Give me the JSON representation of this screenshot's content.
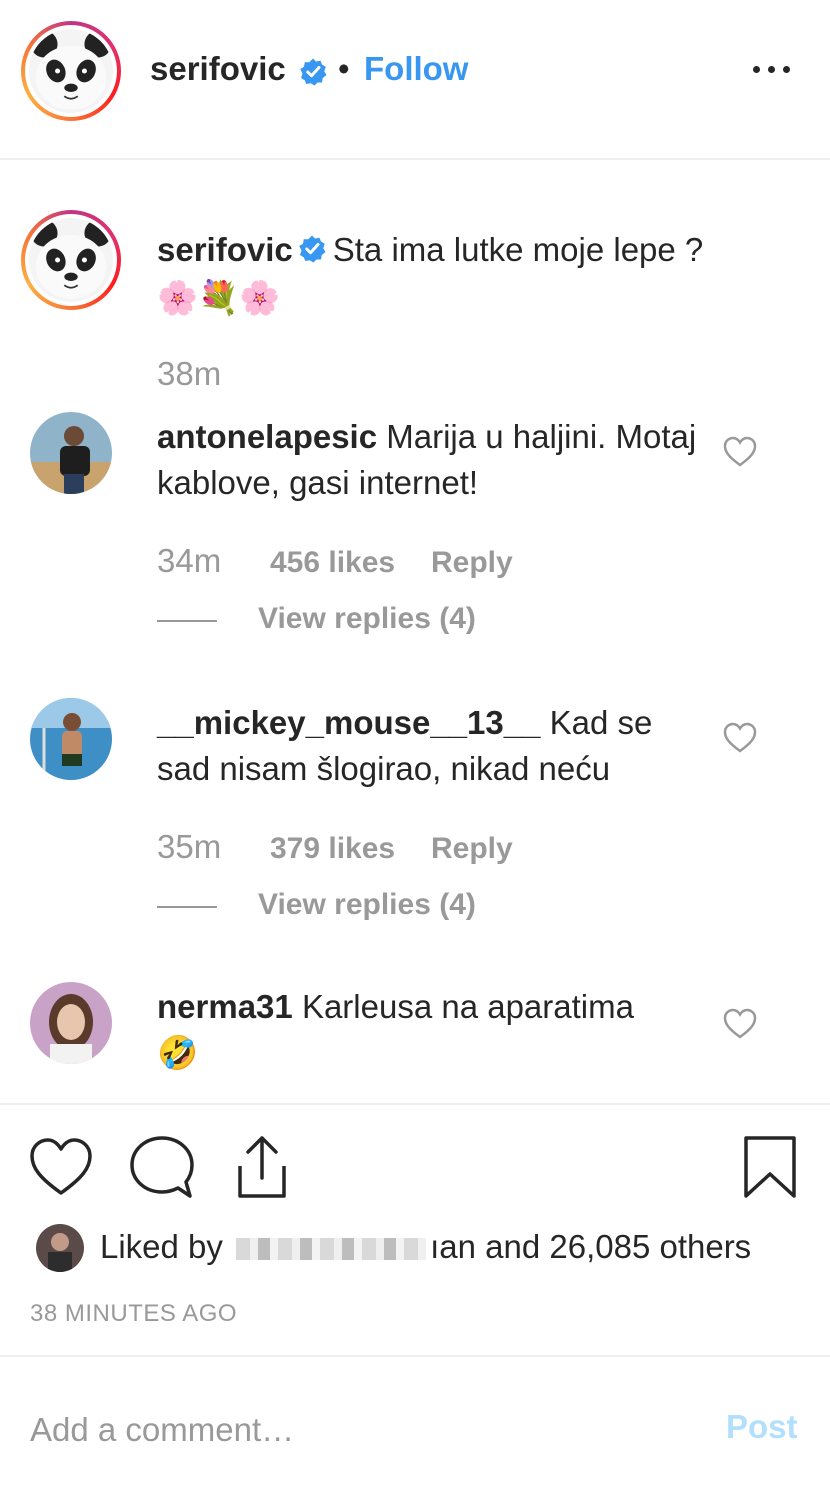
{
  "header": {
    "username": "serifovic",
    "separator": "•",
    "follow_label": "Follow"
  },
  "caption": {
    "username": "serifovic",
    "text": "Sta ima lutke moje lepe ?",
    "emojis": "🌸💐🌸",
    "time": "38m"
  },
  "comments": [
    {
      "username": "antonelapesic",
      "text": "Marija u haljini. Motaj kablove, gasi internet!",
      "time": "34m",
      "likes": "456 likes",
      "reply_label": "Reply",
      "view_replies": "View replies (4)"
    },
    {
      "username": "__mickey_mouse__13__",
      "text": "Kad se sad nisam šlogirao, nikad neću",
      "time": "35m",
      "likes": "379 likes",
      "reply_label": "Reply",
      "view_replies": "View replies (4)"
    },
    {
      "username": "nerma31",
      "text": "Karleusa na aparatima",
      "emoji": "🤣"
    }
  ],
  "likes": {
    "prefix": "Liked by",
    "suffix": "ıan and 26,085 others"
  },
  "time_ago": "38 MINUTES AGO",
  "comment_box": {
    "placeholder": "Add a comment…",
    "post_label": "Post"
  },
  "colors": {
    "accent": "#3897f0",
    "post_disabled": "#b2dffc",
    "muted": "#999999"
  }
}
